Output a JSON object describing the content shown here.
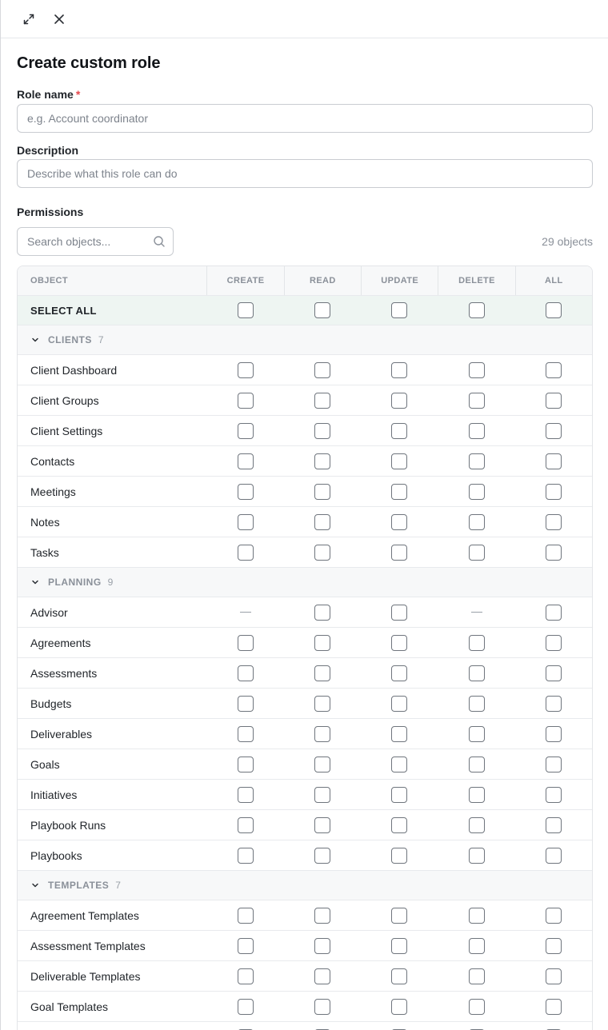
{
  "topbar": {
    "expand_icon": "expand-icon",
    "close_icon": "close-icon"
  },
  "title": "Create custom role",
  "role_name": {
    "label": "Role name",
    "required_marker": "*",
    "placeholder": "e.g. Account coordinator",
    "value": ""
  },
  "description": {
    "label": "Description",
    "placeholder": "Describe what this role can do",
    "value": ""
  },
  "permissions": {
    "label": "Permissions",
    "search_placeholder": "Search objects...",
    "object_count": "29 objects",
    "columns": {
      "object": "OBJECT",
      "create": "CREATE",
      "read": "READ",
      "update": "UPDATE",
      "delete": "DELETE",
      "all": "ALL"
    },
    "select_all_label": "SELECT ALL",
    "groups": [
      {
        "name": "CLIENTS",
        "count": "7",
        "rows": [
          {
            "name": "Client Dashboard",
            "cells": [
              "cb",
              "cb",
              "cb",
              "cb",
              "cb"
            ]
          },
          {
            "name": "Client Groups",
            "cells": [
              "cb",
              "cb",
              "cb",
              "cb",
              "cb"
            ]
          },
          {
            "name": "Client Settings",
            "cells": [
              "cb",
              "cb",
              "cb",
              "cb",
              "cb"
            ]
          },
          {
            "name": "Contacts",
            "cells": [
              "cb",
              "cb",
              "cb",
              "cb",
              "cb"
            ]
          },
          {
            "name": "Meetings",
            "cells": [
              "cb",
              "cb",
              "cb",
              "cb",
              "cb"
            ]
          },
          {
            "name": "Notes",
            "cells": [
              "cb",
              "cb",
              "cb",
              "cb",
              "cb"
            ]
          },
          {
            "name": "Tasks",
            "cells": [
              "cb",
              "cb",
              "cb",
              "cb",
              "cb"
            ]
          }
        ]
      },
      {
        "name": "PLANNING",
        "count": "9",
        "rows": [
          {
            "name": "Advisor",
            "cells": [
              "dash",
              "cb",
              "cb",
              "dash",
              "cb"
            ]
          },
          {
            "name": "Agreements",
            "cells": [
              "cb",
              "cb",
              "cb",
              "cb",
              "cb"
            ]
          },
          {
            "name": "Assessments",
            "cells": [
              "cb",
              "cb",
              "cb",
              "cb",
              "cb"
            ]
          },
          {
            "name": "Budgets",
            "cells": [
              "cb",
              "cb",
              "cb",
              "cb",
              "cb"
            ]
          },
          {
            "name": "Deliverables",
            "cells": [
              "cb",
              "cb",
              "cb",
              "cb",
              "cb"
            ]
          },
          {
            "name": "Goals",
            "cells": [
              "cb",
              "cb",
              "cb",
              "cb",
              "cb"
            ]
          },
          {
            "name": "Initiatives",
            "cells": [
              "cb",
              "cb",
              "cb",
              "cb",
              "cb"
            ]
          },
          {
            "name": "Playbook Runs",
            "cells": [
              "cb",
              "cb",
              "cb",
              "cb",
              "cb"
            ]
          },
          {
            "name": "Playbooks",
            "cells": [
              "cb",
              "cb",
              "cb",
              "cb",
              "cb"
            ]
          }
        ]
      },
      {
        "name": "TEMPLATES",
        "count": "7",
        "rows": [
          {
            "name": "Agreement Templates",
            "cells": [
              "cb",
              "cb",
              "cb",
              "cb",
              "cb"
            ]
          },
          {
            "name": "Assessment Templates",
            "cells": [
              "cb",
              "cb",
              "cb",
              "cb",
              "cb"
            ]
          },
          {
            "name": "Deliverable Templates",
            "cells": [
              "cb",
              "cb",
              "cb",
              "cb",
              "cb"
            ]
          },
          {
            "name": "Goal Templates",
            "cells": [
              "cb",
              "cb",
              "cb",
              "cb",
              "cb"
            ]
          },
          {
            "name": "",
            "cells": [
              "cb",
              "cb",
              "cb",
              "cb",
              "cb"
            ]
          }
        ]
      }
    ]
  }
}
